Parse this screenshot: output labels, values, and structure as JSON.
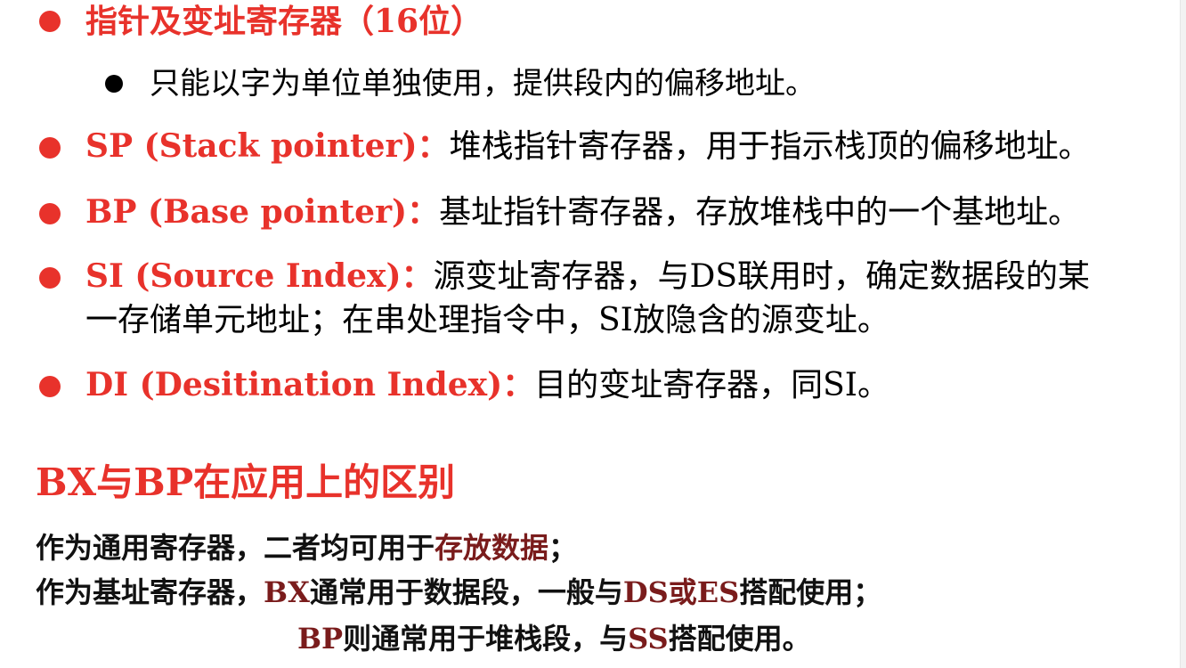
{
  "items": {
    "pointer_header": "指针及变址寄存器（16位）",
    "pointer_sub": "只能以字为单位单独使用，提供段内的偏移地址。",
    "sp_label": "SP (Stack pointer)：",
    "sp_desc": "堆栈指针寄存器，用于指示栈顶的偏移地址。",
    "bp_label": "BP (Base pointer)：",
    "bp_desc": "基址指针寄存器，存放堆栈中的一个基地址。",
    "si_label": "SI (Source Index)：",
    "si_desc_1a": "源变址寄存器，与",
    "si_desc_1b": "DS",
    "si_desc_1c": "联用时，确定数据段的某",
    "si_desc_2a": "一存储单元地址；在串处理指令中，",
    "si_desc_2b": "SI",
    "si_desc_2c": "放隐含的源变址。",
    "di_label": "DI (Desitination Index)：",
    "di_desc_a": "目的变址寄存器，同",
    "di_desc_b": "SI",
    "di_desc_c": "。"
  },
  "section": {
    "title": "BX与BP在应用上的区别",
    "line1_a": "作为通用寄存器，二者均可用于",
    "line1_b": "存放数据",
    "line1_c": "；",
    "line2_a": "作为基址寄存器，",
    "line2_b": "BX",
    "line2_c": "通常用于数据段，一般与",
    "line2_d": "DS或ES",
    "line2_e": "搭配使用；",
    "line3_a": "BP",
    "line3_b": "则通常用于堆栈段，与",
    "line3_c": "SS",
    "line3_d": "搭配使用。"
  },
  "colors": {
    "accent_red": "#e8322b",
    "dark_red": "#7a1c1c",
    "text": "#000000"
  }
}
